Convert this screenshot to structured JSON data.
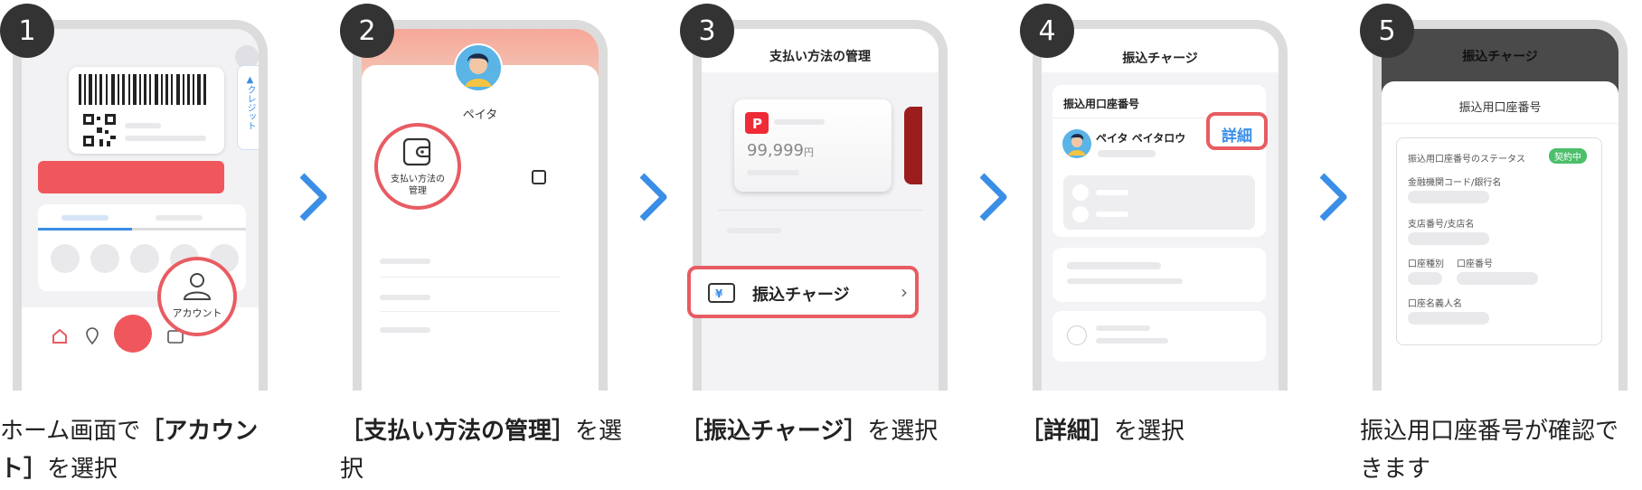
{
  "steps": [
    {
      "number": "1",
      "caption_bold": "［アカウント］",
      "caption_pre": "ホーム画面で",
      "caption_post": "を選択",
      "screen": {
        "credit_tab": "▲クレジット",
        "account_label": "アカウント"
      }
    },
    {
      "number": "2",
      "caption_bold": "［支払い方法の管理］",
      "caption_pre": "",
      "caption_post": "を選択",
      "screen": {
        "user_name": "ペイタ",
        "menu_label": "支払い方法の管理"
      }
    },
    {
      "number": "3",
      "caption_bold": "［振込チャージ］",
      "caption_pre": "",
      "caption_post": "を選択",
      "screen": {
        "title": "支払い方法の管理",
        "balance": "99,999",
        "currency": "円",
        "charge_label": "振込チャージ",
        "chevron": "›"
      }
    },
    {
      "number": "4",
      "caption_bold": "［詳細］",
      "caption_pre": "",
      "caption_post": "を選択",
      "screen": {
        "title": "振込チャージ",
        "section": "振込用口座番号",
        "account_name": "ペイタ ペイタロウ",
        "detail_button": "詳細"
      }
    },
    {
      "number": "5",
      "caption_bold": "",
      "caption_pre": "振込用口座番号が確認できます",
      "caption_post": "",
      "screen": {
        "title": "振込チャージ",
        "subtitle": "振込用口座番号",
        "status_label": "振込用口座番号のステータス",
        "status_badge": "契約中",
        "bank_label": "金融機関コード/銀行名",
        "branch_label": "支店番号/支店名",
        "type_label": "口座種別",
        "number_label": "口座番号",
        "holder_label": "口座名義人名"
      }
    }
  ],
  "colors": {
    "accent_red": "#e85c62",
    "arrow_blue": "#3a8ee6",
    "status_green": "#4cbf6b"
  }
}
